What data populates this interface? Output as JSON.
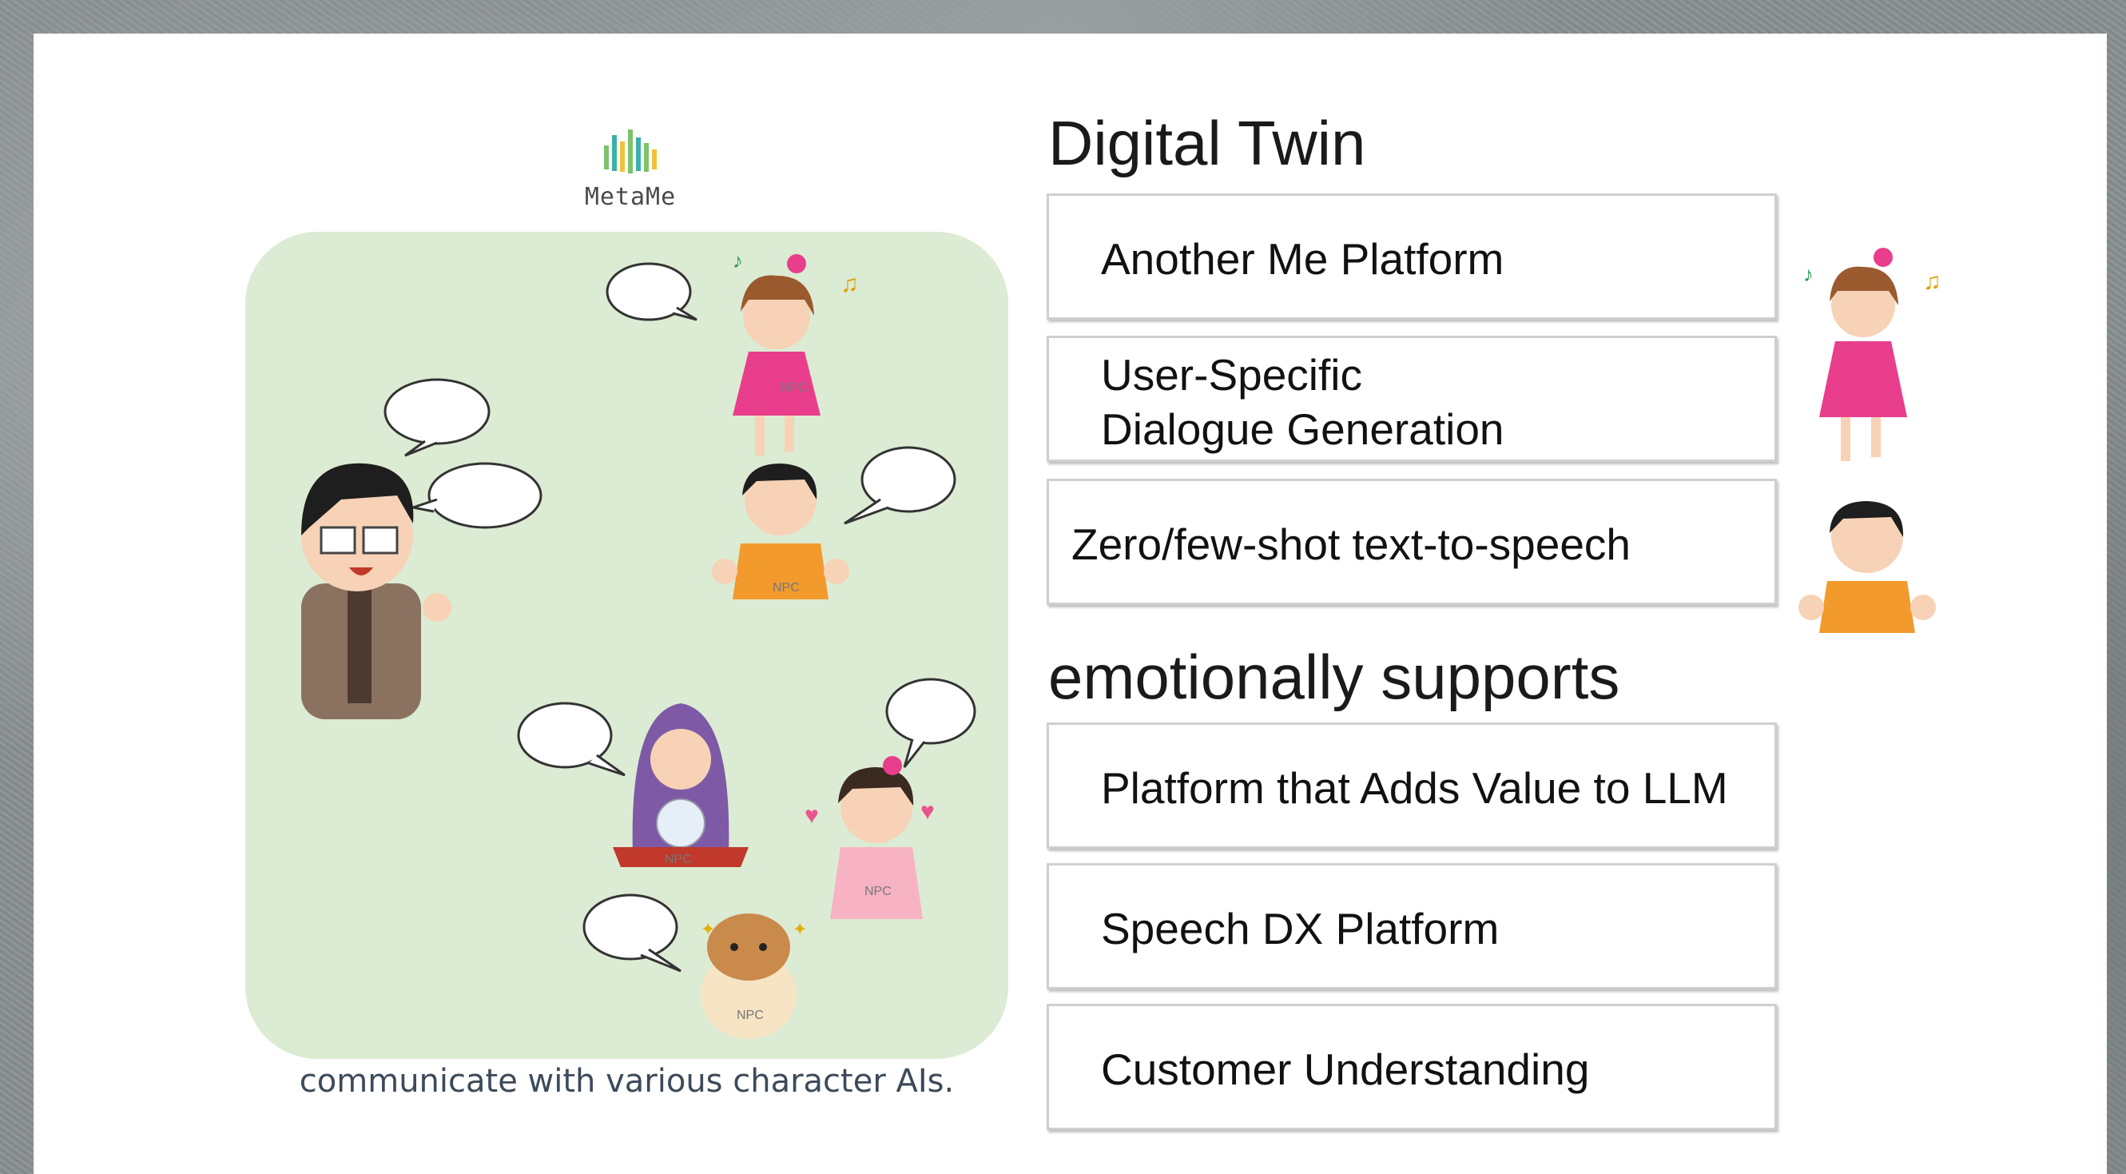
{
  "logo": {
    "name": "MetaMe"
  },
  "scene": {
    "caption": "communicate with various character AIs.",
    "npc_tag": "NPC"
  },
  "sections": [
    {
      "heading": "Digital Twin",
      "items": [
        "Another Me Platform",
        "User-Specific\nDialogue Generation",
        "Zero/few-shot text-to-speech"
      ]
    },
    {
      "heading": "emotionally supports",
      "items": [
        "Platform that Adds Value to LLM",
        "Speech DX Platform",
        "Customer Understanding"
      ]
    }
  ],
  "colors": {
    "scene_bg": "#dcebd3",
    "logo_green": "#7cc36a",
    "logo_teal": "#3ab0a8"
  }
}
